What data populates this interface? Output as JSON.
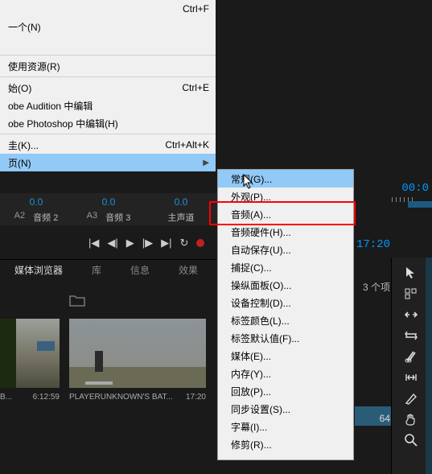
{
  "top_menu": {
    "items": [
      {
        "label": "",
        "shortcut": "Ctrl+F"
      },
      {
        "label": "一个(N)",
        "shortcut": ""
      },
      {
        "label": "",
        "shortcut": ""
      },
      {
        "label": "使用资源(R)",
        "shortcut": ""
      },
      {
        "label": "始(O)",
        "shortcut": "Ctrl+E"
      },
      {
        "label": "obe Audition 中编辑",
        "shortcut": ""
      },
      {
        "label": "obe Photoshop 中编辑(H)",
        "shortcut": ""
      },
      {
        "label": "圭(K)...",
        "shortcut": "Ctrl+Alt+K"
      },
      {
        "label": "页(N)",
        "shortcut": ""
      }
    ]
  },
  "sub_menu": {
    "items": [
      "常规(G)...",
      "外观(P)...",
      "音频(A)...",
      "音频硬件(H)...",
      "自动保存(U)...",
      "捕捉(C)...",
      "操纵面板(O)...",
      "设备控制(D)...",
      "标签颜色(L)...",
      "标签默认值(F)...",
      "媒体(E)...",
      "内存(Y)...",
      "回放(P)...",
      "同步设置(S)...",
      "字幕(I)...",
      "修剪(R)..."
    ],
    "selected_index": 0,
    "highlight_index": 2
  },
  "audio_tracks": {
    "cells": [
      {
        "val": "0.0",
        "idx": "A2",
        "lbl": "音频 2"
      },
      {
        "val": "0.0",
        "idx": "A3",
        "lbl": "音频 3"
      },
      {
        "val": "0.0",
        "idx": "",
        "lbl": "主声道"
      }
    ]
  },
  "timecode_right_top": "00:0",
  "timecode_right": "17:20",
  "panel_tabs": [
    "媒体浏览器",
    "库",
    "信息",
    "效果"
  ],
  "items_count": "3 个项",
  "thumbs": [
    {
      "name": "B...",
      "dur": "6:12:59"
    },
    {
      "name": "PLAYERUNKNOWN'S BAT...",
      "dur": "17:20"
    }
  ],
  "thumb3_dur": "64",
  "tools": {
    "cursor": "▷",
    "track_select": "⊞",
    "ripple": "↔",
    "rate": "⇆",
    "razor": "✂",
    "slip": "|↔|",
    "pen": "✎",
    "hand": "✋",
    "zoom": "🔍"
  },
  "transport": {
    "goto_in": "|◀",
    "step_back": "◀|",
    "play": "▶",
    "step_fwd": "|▶",
    "goto_out": "▶|",
    "loop": "↻"
  }
}
